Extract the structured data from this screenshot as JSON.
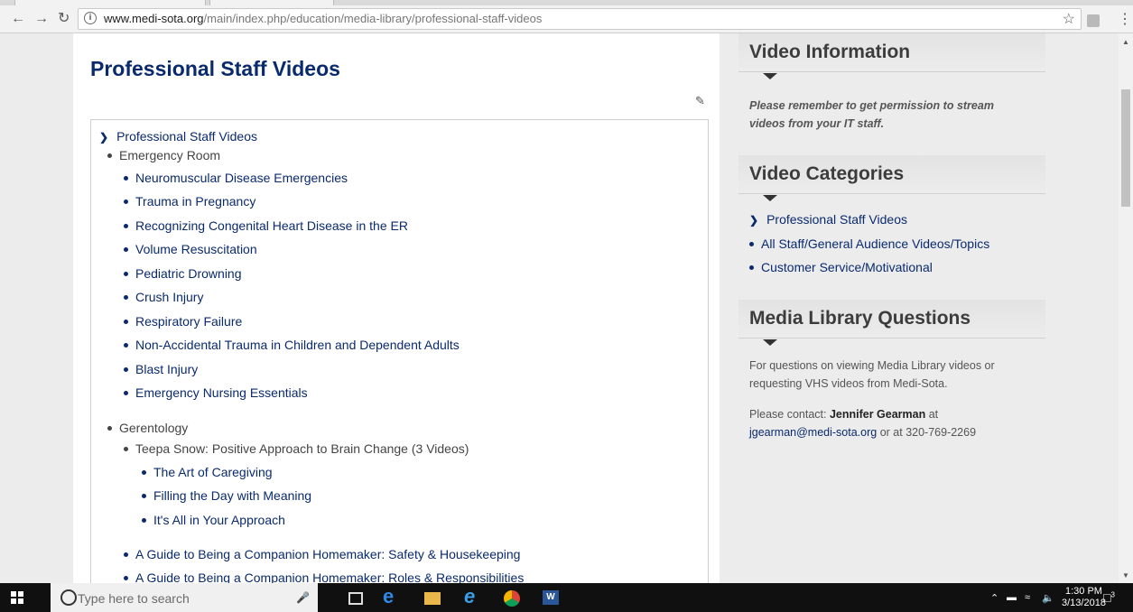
{
  "browser": {
    "url_host": "www.medi-sota.org",
    "url_path": "/main/index.php/education/media-library/professional-staff-videos"
  },
  "page": {
    "title": "Professional Staff Videos",
    "tree": {
      "root": "Professional Staff Videos",
      "section1": "Emergency Room",
      "er_items": [
        "Neuromuscular Disease Emergencies",
        "Trauma in Pregnancy",
        "Recognizing Congenital Heart Disease in the ER",
        "Volume Resuscitation",
        "Pediatric Drowning",
        "Crush Injury",
        "Respiratory Failure",
        "Non-Accidental Trauma in Children and Dependent Adults",
        "Blast Injury",
        "Emergency Nursing Essentials"
      ],
      "section2": "Gerentology",
      "teepa": "Teepa Snow: Positive Approach to Brain Change (3 Videos)",
      "teepa_items": [
        "The Art of Caregiving",
        "Filling the Day with Meaning",
        "It's All in Your Approach"
      ],
      "companion": [
        "A Guide to Being a Companion Homemaker: Safety & Housekeeping",
        "A Guide to Being a Companion Homemaker: Roles & Responsibilities"
      ]
    }
  },
  "sidebar": {
    "video_info": {
      "title": "Video Information",
      "note": "Please remember to get permission to stream videos from your IT staff."
    },
    "categories": {
      "title": "Video Categories",
      "items": [
        "Professional Staff Videos",
        "All Staff/General Audience Videos/Topics",
        "Customer Service/Motivational"
      ]
    },
    "questions": {
      "title": "Media Library Questions",
      "text": "For questions on viewing Media Library videos or requesting VHS videos from Medi-Sota.",
      "contact_prefix": "Please contact: ",
      "contact_name": "Jennifer Gearman",
      "contact_at": " at",
      "email": "jgearman@medi-sota.org",
      "phone_text": " or at 320-769-2269"
    }
  },
  "taskbar": {
    "search_placeholder": "Type here to search",
    "time": "1:30 PM",
    "date": "3/13/2018",
    "notification_count": "3"
  },
  "colors": {
    "link": "#0a2a6e",
    "taskbar": "#101010"
  }
}
